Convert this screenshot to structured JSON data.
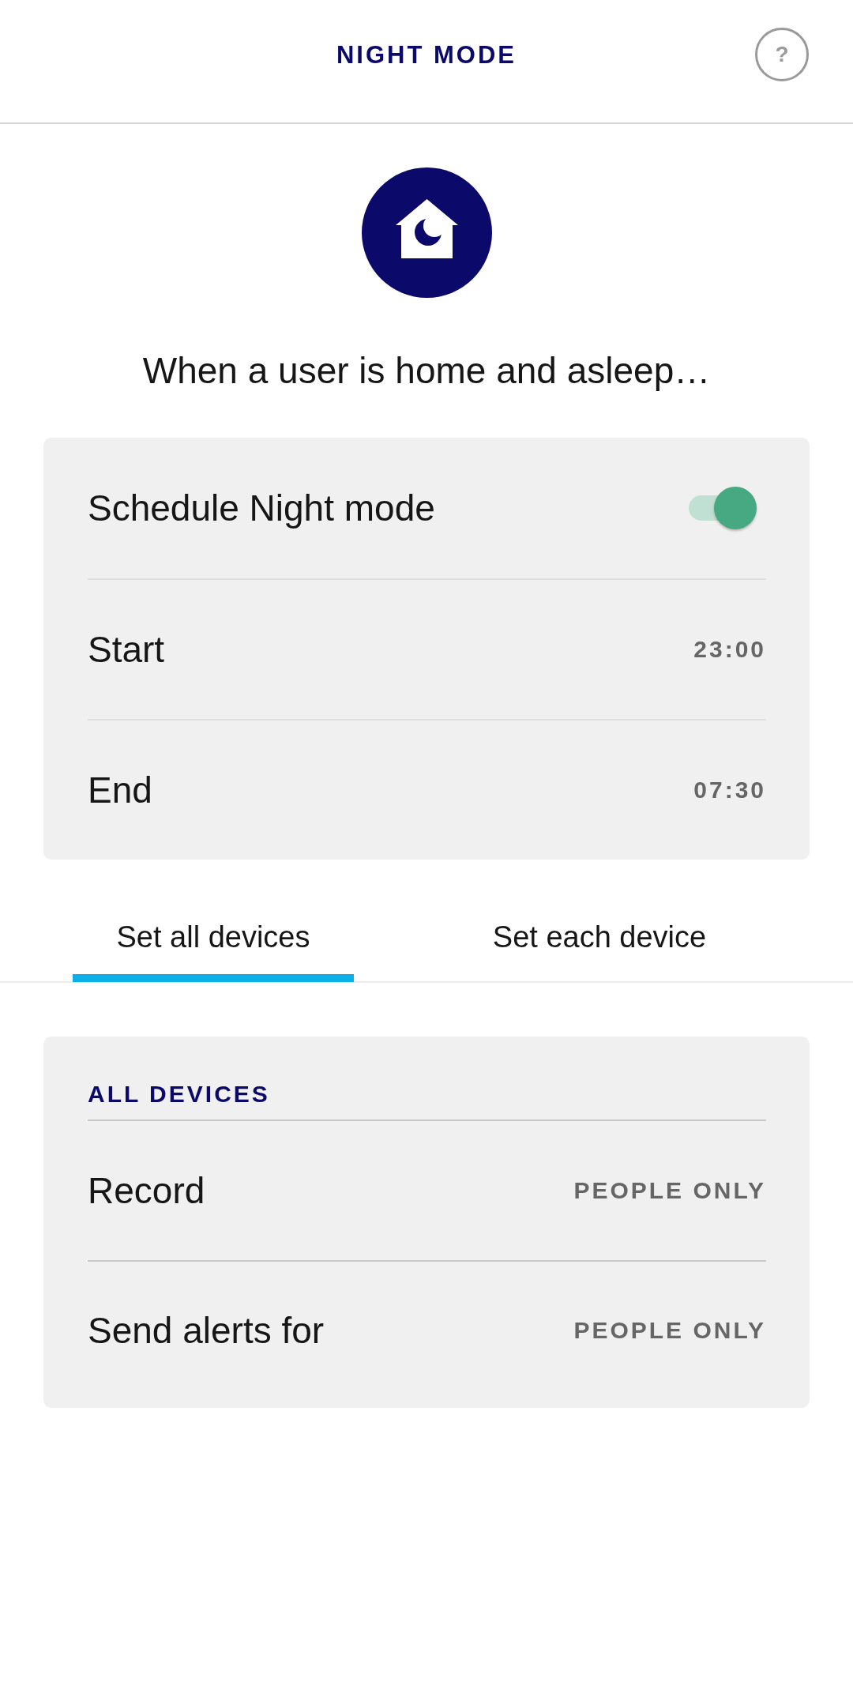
{
  "header": {
    "title": "NIGHT MODE",
    "help_button": "?"
  },
  "intro": {
    "text": "When a user is home and asleep…"
  },
  "schedule": [
    {
      "kind": "toggle",
      "label": "Schedule Night mode",
      "on": true
    },
    {
      "kind": "value",
      "label": "Start",
      "value": "23:00"
    },
    {
      "kind": "value",
      "label": "End",
      "value": "07:30"
    }
  ],
  "tabs": [
    {
      "label": "Set all devices",
      "selected": true
    },
    {
      "label": "Set each device",
      "selected": false
    }
  ],
  "devices": {
    "heading": "ALL DEVICES",
    "rows": [
      {
        "label": "Record",
        "value": "PEOPLE ONLY"
      },
      {
        "label": "Send alerts for",
        "value": "PEOPLE ONLY"
      }
    ]
  }
}
